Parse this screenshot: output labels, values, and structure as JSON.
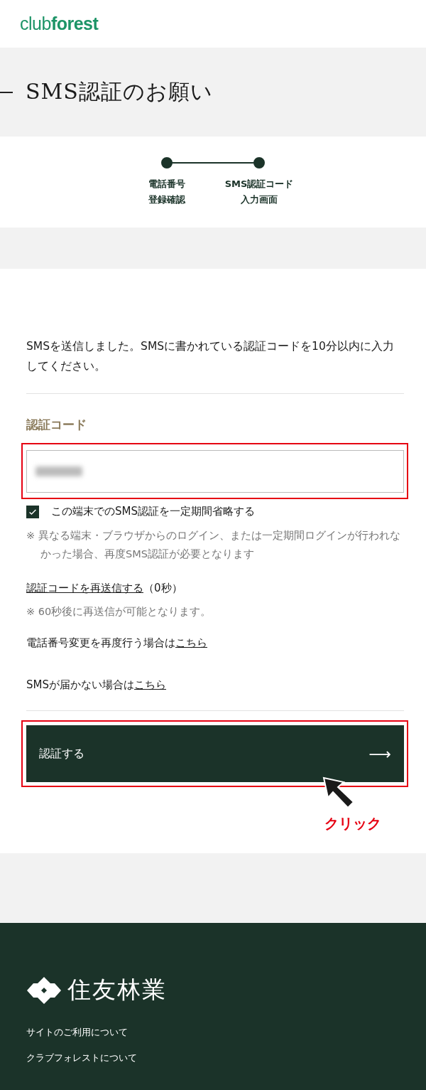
{
  "header": {
    "logo": "club**forest**"
  },
  "page_title": "SMS認証のお願い",
  "steps": [
    {
      "label": "電話番号",
      "sub": "登録確認",
      "done": true
    },
    {
      "label": "SMS認証コード",
      "sub": "入力画面",
      "done": true
    }
  ],
  "message": "SMSを送信しました。SMSに書かれている認証コードを10分以内に入力してください。",
  "code_field": {
    "label": "認証コード",
    "redacted": true
  },
  "skip_option": {
    "label": "この端末でのSMS認証を一定期間省略する",
    "checked": true
  },
  "skip_note": "※ 異なる端末・ブラウザからのログイン、または一定期間ログインが行われなかった場合、再度SMS認証が必要となります",
  "resend": {
    "link": "認証コードを再送信する",
    "count": "（0秒）",
    "note": "※ 60秒後に再送信が可能となります。"
  },
  "phone_change": {
    "text": "電話番号変更を再度行う場合は",
    "link": "こちら"
  },
  "no_sms": {
    "text": "SMSが届かない場合は",
    "link": "こちら"
  },
  "submit": {
    "label": "認証する",
    "arrow": "⟶"
  },
  "annotation": {
    "label": "クリック"
  },
  "footer": {
    "brand": "住友林業",
    "links": [
      "サイトのご利用について",
      "クラブフォレストについて"
    ]
  }
}
